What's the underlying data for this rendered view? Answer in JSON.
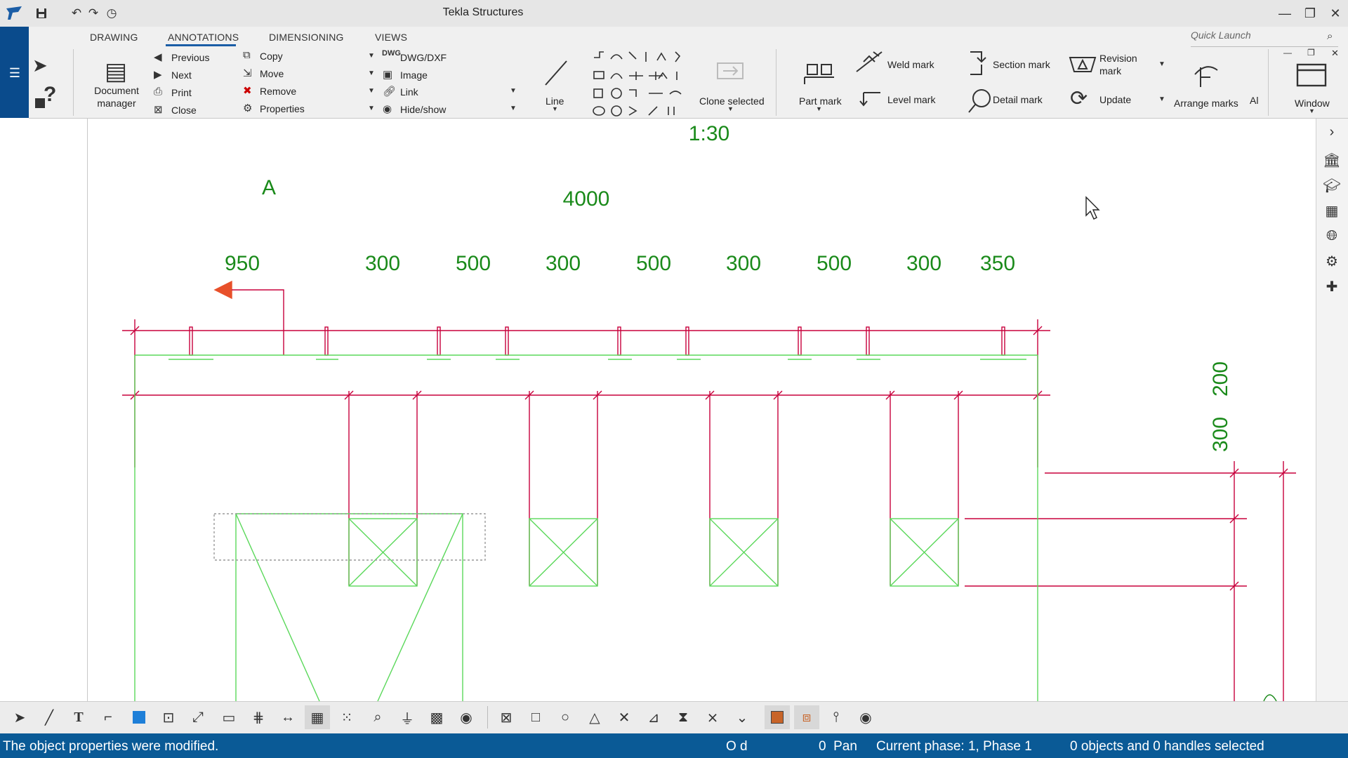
{
  "window": {
    "title": "Tekla Structures"
  },
  "quick_access": {
    "save_icon": "save-icon",
    "undo_icon": "undo-icon",
    "redo_icon": "redo-icon",
    "history_icon": "history-icon"
  },
  "window_controls": {
    "minimize": "—",
    "restore": "❐",
    "close": "✕"
  },
  "tabs": [
    "DRAWING",
    "ANNOTATIONS",
    "DIMENSIONING",
    "VIEWS"
  ],
  "quick_launch": {
    "placeholder": "Quick Launch"
  },
  "ribbon": {
    "document_manager": "Document manager",
    "nav": {
      "previous": "Previous",
      "next": "Next",
      "print": "Print",
      "close": "Close"
    },
    "edit": {
      "copy": "Copy",
      "move": "Move",
      "remove": "Remove",
      "properties": "Properties"
    },
    "insert": {
      "dwg": "DWG/DXF",
      "image": "Image",
      "link": "Link",
      "hide_show": "Hide/show"
    },
    "line": "Line",
    "clone_selected": "Clone selected",
    "part_mark": "Part mark",
    "weld_mark": "Weld mark",
    "level_mark": "Level mark",
    "section_mark": "Section mark",
    "detail_mark": "Detail mark",
    "revision_mark": "Revision mark",
    "update": "Update",
    "arrange_marks": "Arrange marks",
    "al": "Al",
    "window": "Window"
  },
  "drawing": {
    "scale": "1:30",
    "section_label": "A",
    "overall_dim": "4000",
    "dims": [
      "950",
      "300",
      "500",
      "300",
      "500",
      "300",
      "500",
      "300",
      "350"
    ],
    "vertical_dims": [
      "200",
      "300"
    ],
    "colors": {
      "dimension": "#c8003c",
      "part": "#5ad85a",
      "text": "#1a8a1a",
      "section": "#e8502a"
    }
  },
  "status": {
    "message": "The object properties were modified.",
    "od": "O d",
    "pan": "0  Pan",
    "phase": "Current phase: 1, Phase 1",
    "selection": "0 objects and 0 handles selected"
  }
}
